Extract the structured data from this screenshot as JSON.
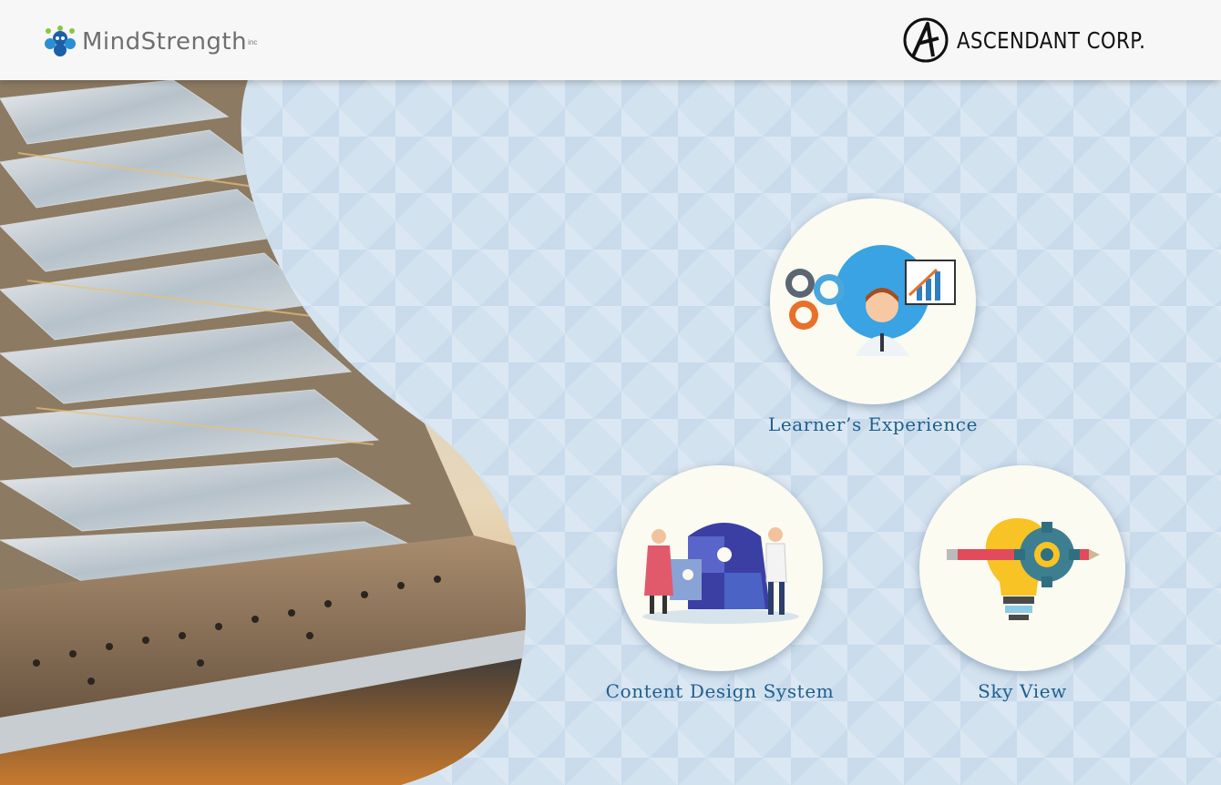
{
  "header": {
    "left_logo": {
      "name": "MindStrength",
      "sup": "inc",
      "icon": "mindstrength-logo-icon"
    },
    "right_logo": {
      "name": "ASCENDANT CORP.",
      "icon": "ascendant-logo-icon"
    }
  },
  "cards": {
    "learner": {
      "label": "Learner’s Experience",
      "icon": "presenter-gears-icon"
    },
    "content": {
      "label": "Content Design System",
      "icon": "puzzle-head-icon"
    },
    "sky": {
      "label": "Sky View",
      "icon": "lightbulb-gear-icon"
    }
  },
  "colors": {
    "accent": "#1d5f8e",
    "background": "#d3e2ef",
    "header": "#f7f7f7"
  }
}
